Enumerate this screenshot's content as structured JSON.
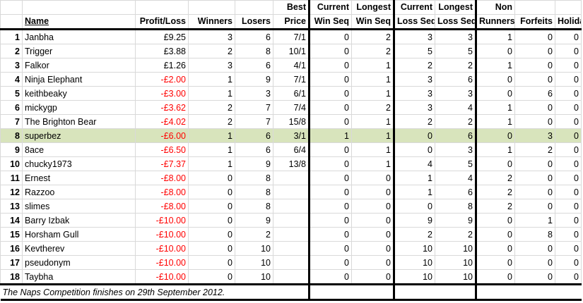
{
  "headers": {
    "row1": {
      "best": "Best",
      "current_win": "Current",
      "longest_win": "Longest",
      "current_loss": "Current",
      "longest_loss": "Longest",
      "non": "Non"
    },
    "row2": {
      "name": "Name",
      "profit": "Profit/Loss",
      "winners": "Winners",
      "losers": "Losers",
      "price": "Price",
      "win_seq": "Win Seq",
      "longest_win_seq": "Win Seq",
      "loss_seq": "Loss Seq",
      "longest_loss_seq": "Loss Seq",
      "runners": "Runners",
      "forfeits": "Forfeits",
      "holiday": "Holiday"
    }
  },
  "rows": [
    {
      "rank": "1",
      "name": "Janbha",
      "profit": "£9.25",
      "winners": "3",
      "losers": "6",
      "price": "7/1",
      "cur_win": "0",
      "long_win": "2",
      "cur_loss": "3",
      "long_loss": "3",
      "non_runners": "1",
      "forfeits": "0",
      "holiday": "0"
    },
    {
      "rank": "2",
      "name": "Trigger",
      "profit": "£3.88",
      "winners": "2",
      "losers": "8",
      "price": "10/1",
      "cur_win": "0",
      "long_win": "2",
      "cur_loss": "5",
      "long_loss": "5",
      "non_runners": "0",
      "forfeits": "0",
      "holiday": "0"
    },
    {
      "rank": "3",
      "name": "Falkor",
      "profit": "£1.26",
      "winners": "3",
      "losers": "6",
      "price": "4/1",
      "cur_win": "0",
      "long_win": "1",
      "cur_loss": "2",
      "long_loss": "2",
      "non_runners": "1",
      "forfeits": "0",
      "holiday": "0"
    },
    {
      "rank": "4",
      "name": "Ninja Elephant",
      "profit": "-£2.00",
      "winners": "1",
      "losers": "9",
      "price": "7/1",
      "cur_win": "0",
      "long_win": "1",
      "cur_loss": "3",
      "long_loss": "6",
      "non_runners": "0",
      "forfeits": "0",
      "holiday": "0"
    },
    {
      "rank": "5",
      "name": "keithbeaky",
      "profit": "-£3.00",
      "winners": "1",
      "losers": "3",
      "price": "6/1",
      "cur_win": "0",
      "long_win": "1",
      "cur_loss": "3",
      "long_loss": "3",
      "non_runners": "0",
      "forfeits": "6",
      "holiday": "0"
    },
    {
      "rank": "6",
      "name": "mickygp",
      "profit": "-£3.62",
      "winners": "2",
      "losers": "7",
      "price": "7/4",
      "cur_win": "0",
      "long_win": "2",
      "cur_loss": "3",
      "long_loss": "4",
      "non_runners": "1",
      "forfeits": "0",
      "holiday": "0"
    },
    {
      "rank": "7",
      "name": "The Brighton Bear",
      "profit": "-£4.02",
      "winners": "2",
      "losers": "7",
      "price": "15/8",
      "cur_win": "0",
      "long_win": "1",
      "cur_loss": "2",
      "long_loss": "2",
      "non_runners": "1",
      "forfeits": "0",
      "holiday": "0"
    },
    {
      "rank": "8",
      "name": "superbez",
      "profit": "-£6.00",
      "winners": "1",
      "losers": "6",
      "price": "3/1",
      "cur_win": "1",
      "long_win": "1",
      "cur_loss": "0",
      "long_loss": "6",
      "non_runners": "0",
      "forfeits": "3",
      "holiday": "0",
      "highlight": true
    },
    {
      "rank": "9",
      "name": "8ace",
      "profit": "-£6.50",
      "winners": "1",
      "losers": "6",
      "price": "6/4",
      "cur_win": "0",
      "long_win": "1",
      "cur_loss": "0",
      "long_loss": "3",
      "non_runners": "1",
      "forfeits": "2",
      "holiday": "0"
    },
    {
      "rank": "10",
      "name": "chucky1973",
      "profit": "-£7.37",
      "winners": "1",
      "losers": "9",
      "price": "13/8",
      "cur_win": "0",
      "long_win": "1",
      "cur_loss": "4",
      "long_loss": "5",
      "non_runners": "0",
      "forfeits": "0",
      "holiday": "0"
    },
    {
      "rank": "11",
      "name": "Ernest",
      "profit": "-£8.00",
      "winners": "0",
      "losers": "8",
      "price": "",
      "cur_win": "0",
      "long_win": "0",
      "cur_loss": "1",
      "long_loss": "4",
      "non_runners": "2",
      "forfeits": "0",
      "holiday": "0"
    },
    {
      "rank": "12",
      "name": "Razzoo",
      "profit": "-£8.00",
      "winners": "0",
      "losers": "8",
      "price": "",
      "cur_win": "0",
      "long_win": "0",
      "cur_loss": "1",
      "long_loss": "6",
      "non_runners": "2",
      "forfeits": "0",
      "holiday": "0"
    },
    {
      "rank": "13",
      "name": "slimes",
      "profit": "-£8.00",
      "winners": "0",
      "losers": "8",
      "price": "",
      "cur_win": "0",
      "long_win": "0",
      "cur_loss": "0",
      "long_loss": "8",
      "non_runners": "2",
      "forfeits": "0",
      "holiday": "0"
    },
    {
      "rank": "14",
      "name": "Barry Izbak",
      "profit": "-£10.00",
      "winners": "0",
      "losers": "9",
      "price": "",
      "cur_win": "0",
      "long_win": "0",
      "cur_loss": "9",
      "long_loss": "9",
      "non_runners": "0",
      "forfeits": "1",
      "holiday": "0"
    },
    {
      "rank": "15",
      "name": "Horsham Gull",
      "profit": "-£10.00",
      "winners": "0",
      "losers": "2",
      "price": "",
      "cur_win": "0",
      "long_win": "0",
      "cur_loss": "2",
      "long_loss": "2",
      "non_runners": "0",
      "forfeits": "8",
      "holiday": "0"
    },
    {
      "rank": "16",
      "name": "Kevtherev",
      "profit": "-£10.00",
      "winners": "0",
      "losers": "10",
      "price": "",
      "cur_win": "0",
      "long_win": "0",
      "cur_loss": "10",
      "long_loss": "10",
      "non_runners": "0",
      "forfeits": "0",
      "holiday": "0"
    },
    {
      "rank": "17",
      "name": "pseudonym",
      "profit": "-£10.00",
      "winners": "0",
      "losers": "10",
      "price": "",
      "cur_win": "0",
      "long_win": "0",
      "cur_loss": "10",
      "long_loss": "10",
      "non_runners": "0",
      "forfeits": "0",
      "holiday": "0"
    },
    {
      "rank": "18",
      "name": "Taybha",
      "profit": "-£10.00",
      "winners": "0",
      "losers": "10",
      "price": "",
      "cur_win": "0",
      "long_win": "0",
      "cur_loss": "10",
      "long_loss": "10",
      "non_runners": "0",
      "forfeits": "0",
      "holiday": "0"
    }
  ],
  "footer": {
    "note": "The Naps Competition finishes on 29th September 2012."
  },
  "colors": {
    "negative": "#ff0000",
    "highlight_row": "#d8e4bc",
    "gridline": "#d9d9d9",
    "border": "#000000"
  }
}
